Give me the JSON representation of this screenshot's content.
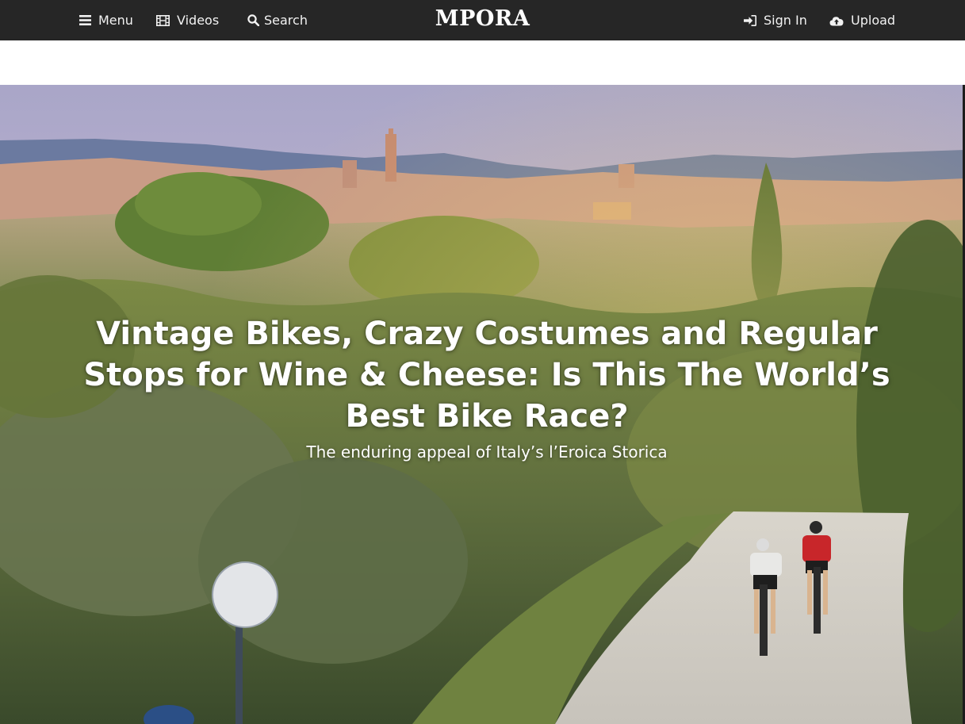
{
  "nav": {
    "menu_label": "Menu",
    "videos_label": "Videos",
    "search_label": "Search",
    "logo_text": "MPORA",
    "signin_label": "Sign In",
    "upload_label": "Upload",
    "icons": {
      "menu": "hamburger-icon",
      "videos": "film-icon",
      "search": "magnifier-icon",
      "signin": "sign-in-arrow-icon",
      "upload": "cloud-upload-icon"
    },
    "colors": {
      "bar": "#262626",
      "text": "#f2f2f2"
    }
  },
  "hero": {
    "title": "Vintage Bikes, Crazy Costumes and Regular Stops for Wine & Cheese: Is This The World’s Best Bike Race?",
    "subtitle": "The enduring appeal of Italy’s l’Eroica Storica"
  }
}
